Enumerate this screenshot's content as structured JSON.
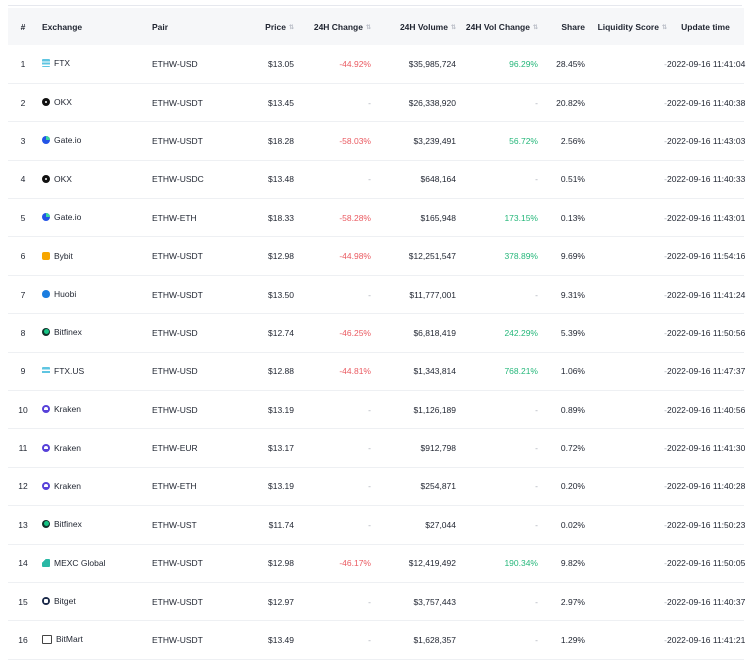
{
  "headers": {
    "rank": "#",
    "exchange": "Exchange",
    "pair": "Pair",
    "price": "Price",
    "change": "24H Change",
    "volume": "24H Volume",
    "vol_change": "24H Vol Change",
    "share": "Share",
    "liquidity": "Liquidity Score",
    "update": "Update time"
  },
  "rows": [
    {
      "rank": "1",
      "exchange": "FTX",
      "icon": "ftx",
      "pair": "ETHW-USD",
      "price": "$13.05",
      "change": "-44.92%",
      "change_dir": "neg",
      "volume": "$35,985,724",
      "vol_change": "96.29%",
      "vol_dir": "pos",
      "share": "28.45%",
      "liquidity": "-",
      "update": "2022-09-16 11:41:04"
    },
    {
      "rank": "2",
      "exchange": "OKX",
      "icon": "okx",
      "pair": "ETHW-USDT",
      "price": "$13.45",
      "change": "-",
      "change_dir": "dash",
      "volume": "$26,338,920",
      "vol_change": "-",
      "vol_dir": "dash",
      "share": "20.82%",
      "liquidity": "-",
      "update": "2022-09-16 11:40:38"
    },
    {
      "rank": "3",
      "exchange": "Gate.io",
      "icon": "gate",
      "pair": "ETHW-USDT",
      "price": "$18.28",
      "change": "-58.03%",
      "change_dir": "neg",
      "volume": "$3,239,491",
      "vol_change": "56.72%",
      "vol_dir": "pos",
      "share": "2.56%",
      "liquidity": "-",
      "update": "2022-09-16 11:43:03"
    },
    {
      "rank": "4",
      "exchange": "OKX",
      "icon": "okx",
      "pair": "ETHW-USDC",
      "price": "$13.48",
      "change": "-",
      "change_dir": "dash",
      "volume": "$648,164",
      "vol_change": "-",
      "vol_dir": "dash",
      "share": "0.51%",
      "liquidity": "-",
      "update": "2022-09-16 11:40:33"
    },
    {
      "rank": "5",
      "exchange": "Gate.io",
      "icon": "gate",
      "pair": "ETHW-ETH",
      "price": "$18.33",
      "change": "-58.28%",
      "change_dir": "neg",
      "volume": "$165,948",
      "vol_change": "173.15%",
      "vol_dir": "pos",
      "share": "0.13%",
      "liquidity": "-",
      "update": "2022-09-16 11:43:01"
    },
    {
      "rank": "6",
      "exchange": "Bybit",
      "icon": "bybit",
      "pair": "ETHW-USDT",
      "price": "$12.98",
      "change": "-44.98%",
      "change_dir": "neg",
      "volume": "$12,251,547",
      "vol_change": "378.89%",
      "vol_dir": "pos",
      "share": "9.69%",
      "liquidity": "-",
      "update": "2022-09-16 11:54:16"
    },
    {
      "rank": "7",
      "exchange": "Huobi",
      "icon": "huobi",
      "pair": "ETHW-USDT",
      "price": "$13.50",
      "change": "-",
      "change_dir": "dash",
      "volume": "$11,777,001",
      "vol_change": "-",
      "vol_dir": "dash",
      "share": "9.31%",
      "liquidity": "-",
      "update": "2022-09-16 11:41:24"
    },
    {
      "rank": "8",
      "exchange": "Bitfinex",
      "icon": "bitfinex",
      "pair": "ETHW-USD",
      "price": "$12.74",
      "change": "-46.25%",
      "change_dir": "neg",
      "volume": "$6,818,419",
      "vol_change": "242.29%",
      "vol_dir": "pos",
      "share": "5.39%",
      "liquidity": "-",
      "update": "2022-09-16 11:50:56"
    },
    {
      "rank": "9",
      "exchange": "FTX.US",
      "icon": "ftxus",
      "pair": "ETHW-USD",
      "price": "$12.88",
      "change": "-44.81%",
      "change_dir": "neg",
      "volume": "$1,343,814",
      "vol_change": "768.21%",
      "vol_dir": "pos",
      "share": "1.06%",
      "liquidity": "-",
      "update": "2022-09-16 11:47:37"
    },
    {
      "rank": "10",
      "exchange": "Kraken",
      "icon": "kraken",
      "pair": "ETHW-USD",
      "price": "$13.19",
      "change": "-",
      "change_dir": "dash",
      "volume": "$1,126,189",
      "vol_change": "-",
      "vol_dir": "dash",
      "share": "0.89%",
      "liquidity": "-",
      "update": "2022-09-16 11:40:56"
    },
    {
      "rank": "11",
      "exchange": "Kraken",
      "icon": "kraken",
      "pair": "ETHW-EUR",
      "price": "$13.17",
      "change": "-",
      "change_dir": "dash",
      "volume": "$912,798",
      "vol_change": "-",
      "vol_dir": "dash",
      "share": "0.72%",
      "liquidity": "-",
      "update": "2022-09-16 11:41:30"
    },
    {
      "rank": "12",
      "exchange": "Kraken",
      "icon": "kraken",
      "pair": "ETHW-ETH",
      "price": "$13.19",
      "change": "-",
      "change_dir": "dash",
      "volume": "$254,871",
      "vol_change": "-",
      "vol_dir": "dash",
      "share": "0.20%",
      "liquidity": "-",
      "update": "2022-09-16 11:40:28"
    },
    {
      "rank": "13",
      "exchange": "Bitfinex",
      "icon": "bitfinex",
      "pair": "ETHW-UST",
      "price": "$11.74",
      "change": "-",
      "change_dir": "dash",
      "volume": "$27,044",
      "vol_change": "-",
      "vol_dir": "dash",
      "share": "0.02%",
      "liquidity": "-",
      "update": "2022-09-16 11:50:23"
    },
    {
      "rank": "14",
      "exchange": "MEXC Global",
      "icon": "mexc",
      "pair": "ETHW-USDT",
      "price": "$12.98",
      "change": "-46.17%",
      "change_dir": "neg",
      "volume": "$12,419,492",
      "vol_change": "190.34%",
      "vol_dir": "pos",
      "share": "9.82%",
      "liquidity": "-",
      "update": "2022-09-16 11:50:05"
    },
    {
      "rank": "15",
      "exchange": "Bitget",
      "icon": "bitget",
      "pair": "ETHW-USDT",
      "price": "$12.97",
      "change": "-",
      "change_dir": "dash",
      "volume": "$3,757,443",
      "vol_change": "-",
      "vol_dir": "dash",
      "share": "2.97%",
      "liquidity": "-",
      "update": "2022-09-16 11:40:37"
    },
    {
      "rank": "16",
      "exchange": "BitMart",
      "icon": "bitmart",
      "pair": "ETHW-USDT",
      "price": "$13.49",
      "change": "-",
      "change_dir": "dash",
      "volume": "$1,628,357",
      "vol_change": "-",
      "vol_dir": "dash",
      "share": "1.29%",
      "liquidity": "-",
      "update": "2022-09-16 11:41:21"
    }
  ],
  "colors": {
    "negative": "#ea5a61",
    "positive": "#25b77a",
    "header_bg": "#f6f7f9"
  }
}
